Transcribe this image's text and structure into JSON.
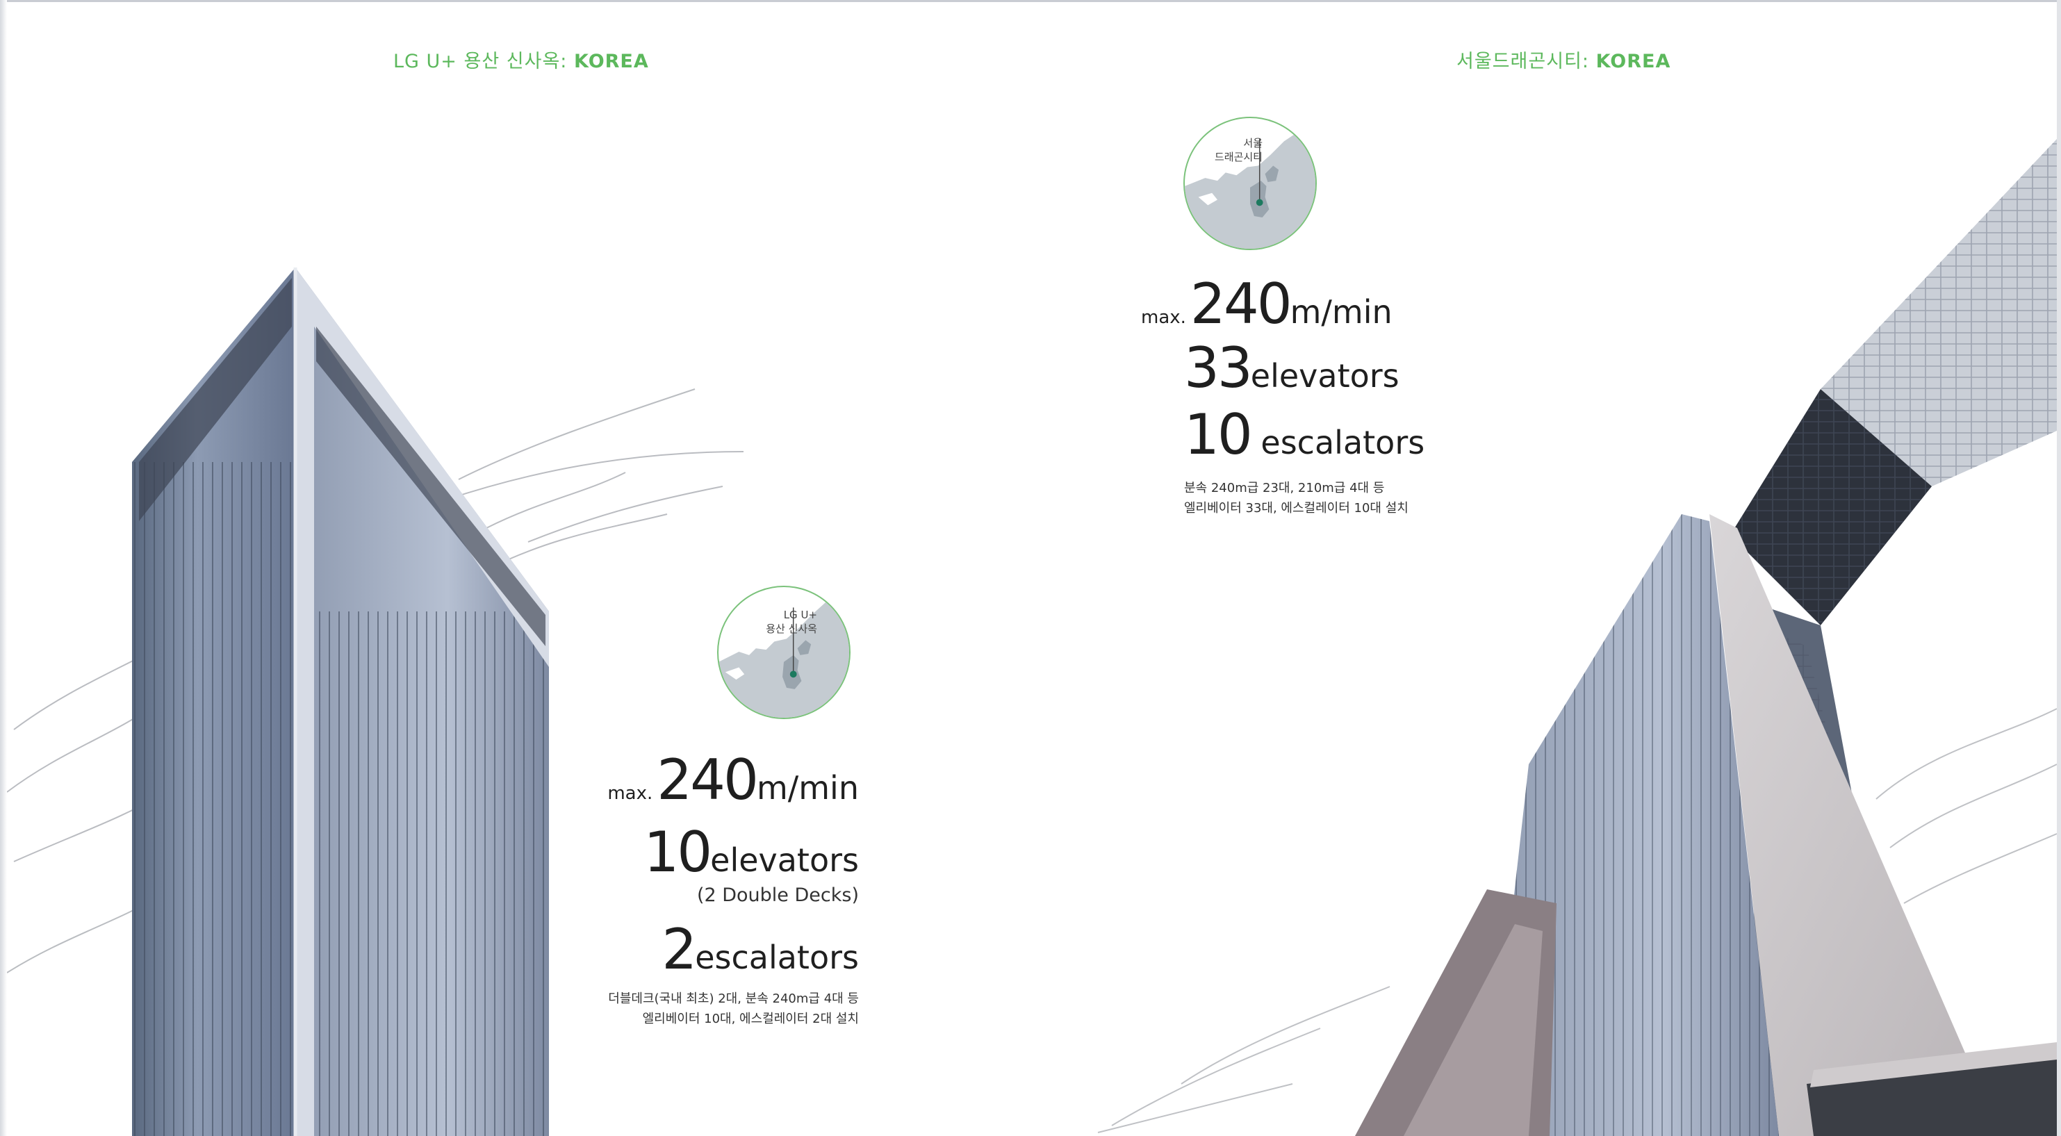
{
  "left": {
    "heading": {
      "name": "LG U+ 용산 신사옥: ",
      "country": "KOREA"
    },
    "map_label": "LG U+\n용산 신사옥",
    "stats": {
      "speed_prefix": "max.",
      "speed_value": "240",
      "speed_unit": "m/min",
      "elevators_value": "10",
      "elevators_unit": "elevators",
      "elevators_sub": "(2 Double Decks)",
      "escalators_value": "2",
      "escalators_unit": "escalators"
    },
    "notes": [
      "더블데크(국내 최초) 2대, 분속 240m급 4대 등",
      "엘리베이터 10대, 에스컬레이터 2대 설치"
    ]
  },
  "right": {
    "heading": {
      "name": "서울드래곤시티: ",
      "country": "KOREA"
    },
    "map_label": "서울\n드래곤시티",
    "stats": {
      "speed_prefix": "max.",
      "speed_value": "240",
      "speed_unit": "m/min",
      "elevators_value": "33",
      "elevators_unit": "elevators",
      "escalators_value": "10",
      "escalators_unit": " escalators"
    },
    "notes": [
      "분속 240m급 23대, 210m급 4대 등",
      "엘리베이터 33대, 에스컬레이터 10대 설치"
    ]
  },
  "colors": {
    "heading_green": "#5cb85c",
    "map_ring": "#7bc27b",
    "map_land": "#c4cbd1",
    "map_highlight": "#9aa5ae",
    "location_dot": "#1d7a5f"
  }
}
